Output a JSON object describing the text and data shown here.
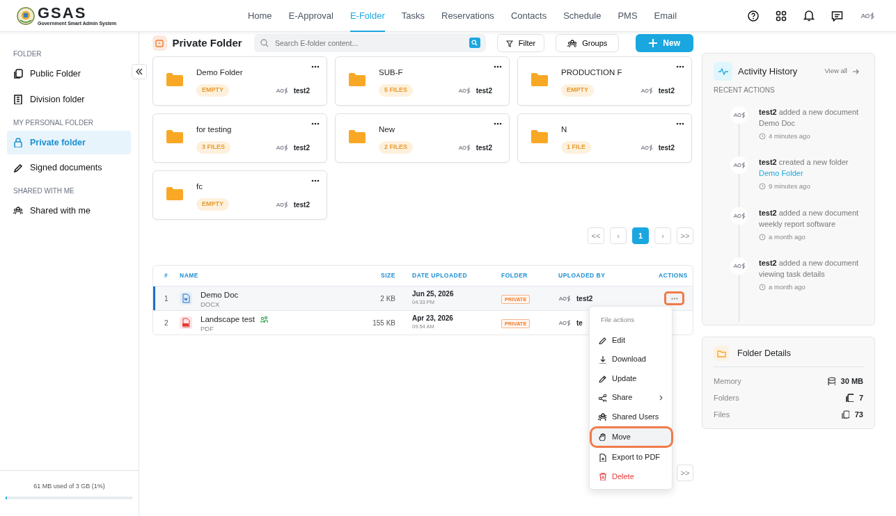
{
  "brand": {
    "name": "GSAS",
    "tagline": "Government Smart Admin System"
  },
  "nav": [
    {
      "label": "Home",
      "selected": false
    },
    {
      "label": "E-Approval",
      "selected": false
    },
    {
      "label": "E-Folder",
      "selected": true
    },
    {
      "label": "Tasks",
      "selected": false
    },
    {
      "label": "Reservations",
      "selected": false
    },
    {
      "label": "Contacts",
      "selected": false
    },
    {
      "label": "Schedule",
      "selected": false
    },
    {
      "label": "PMS",
      "selected": false
    },
    {
      "label": "Email",
      "selected": false
    }
  ],
  "sidebar": {
    "sections": [
      {
        "title": "FOLDER",
        "items": [
          {
            "label": "Public Folder",
            "selected": false
          },
          {
            "label": "Division folder",
            "selected": false
          }
        ]
      },
      {
        "title": "MY PERSONAL FOLDER",
        "items": [
          {
            "label": "Private folder",
            "selected": true
          },
          {
            "label": "Signed documents",
            "selected": false
          }
        ]
      },
      {
        "title": "SHARED WITH ME",
        "items": [
          {
            "label": "Shared with me",
            "selected": false
          }
        ]
      }
    ],
    "storage": {
      "text": "61 MB used of 3 GB (1%)",
      "level": 0.01
    }
  },
  "header": {
    "title": "Private Folder",
    "search_placeholder": "Search E-folder content...",
    "buttons": [
      "Filter",
      "Groups"
    ],
    "new_button": "New"
  },
  "folders": [
    {
      "name": "Demo Folder",
      "badge": "EMPTY",
      "owner": "test2"
    },
    {
      "name": "SUB-F",
      "badge": "5 FILES",
      "owner": "test2"
    },
    {
      "name": "PRODUCTION F",
      "badge": "EMPTY",
      "owner": "test2"
    },
    {
      "name": "for testing",
      "badge": "3 FILES",
      "owner": "test2"
    },
    {
      "name": "New",
      "badge": "2 FILES",
      "owner": "test2"
    },
    {
      "name": "N",
      "badge": "1 FILE",
      "owner": "test2"
    },
    {
      "name": "fc",
      "badge": "EMPTY",
      "owner": "test2"
    }
  ],
  "folder_pagination": {
    "first": "<<",
    "prev": "‹",
    "pages": [
      {
        "label": "1",
        "selected": true
      }
    ],
    "next": "›",
    "last": ">>"
  },
  "table": {
    "columns": [
      "#",
      "NAME",
      "SIZE",
      "DATE UPLOADED",
      "FOLDER",
      "UPLOADED BY",
      "ACTIONS"
    ],
    "rows": [
      {
        "index": "1",
        "name": "Demo Doc",
        "type": "DOCX",
        "kind": "docx",
        "shared": false,
        "size": "2 KB",
        "date": "Jun 25, 2026",
        "time": "04:33 PM",
        "folder": "PRIVATE",
        "uploader": "test2",
        "selected": true
      },
      {
        "index": "2",
        "name": "Landscape test",
        "type": "PDF",
        "kind": "pdf",
        "shared": true,
        "size": "155 KB",
        "date": "Apr 23, 2026",
        "time": "09:54 AM",
        "folder": "PRIVATE",
        "uploader": "te",
        "selected": false
      }
    ]
  },
  "file_pagination": {
    "last": ">>"
  },
  "menu": {
    "title": "File actions",
    "items": [
      {
        "label": "Edit",
        "selected": false,
        "danger": false,
        "submenu": false
      },
      {
        "label": "Download",
        "selected": false,
        "danger": false,
        "submenu": false
      },
      {
        "label": "Update",
        "selected": false,
        "danger": false,
        "submenu": false
      },
      {
        "label": "Share",
        "selected": false,
        "danger": false,
        "submenu": true
      },
      {
        "label": "Shared Users",
        "selected": false,
        "danger": false,
        "submenu": false
      },
      {
        "label": "Move",
        "selected": true,
        "danger": false,
        "submenu": false
      },
      {
        "label": "Export to PDF",
        "selected": false,
        "danger": false,
        "submenu": false
      },
      {
        "label": "Delete",
        "selected": false,
        "danger": true,
        "submenu": false
      }
    ]
  },
  "activity": {
    "title": "Activity History",
    "view_all": "View all",
    "subtitle": "RECENT ACTIONS",
    "items": [
      {
        "user": "test2",
        "action": "added a new document",
        "target": "Demo Doc",
        "target_link": false,
        "time": "4 minutes ago"
      },
      {
        "user": "test2",
        "action": "created a new folder",
        "target": "Demo Folder",
        "target_link": true,
        "time": "9 minutes ago"
      },
      {
        "user": "test2",
        "action": "added a new document",
        "target": "weekly report software",
        "target_link": false,
        "time": "a month ago"
      },
      {
        "user": "test2",
        "action": "added a new document",
        "target": "viewing task details",
        "target_link": false,
        "time": "a month ago"
      }
    ]
  },
  "details": {
    "title": "Folder Details",
    "rows": [
      {
        "label": "Memory",
        "value": "30 MB"
      },
      {
        "label": "Folders",
        "value": "7"
      },
      {
        "label": "Files",
        "value": "73"
      }
    ]
  }
}
